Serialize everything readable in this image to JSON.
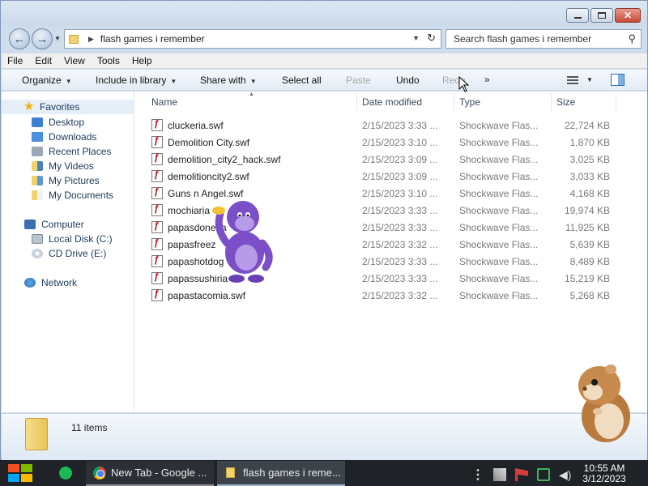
{
  "address": {
    "path": "flash games i remember",
    "search_placeholder": "Search flash games i remember"
  },
  "menu": [
    "File",
    "Edit",
    "View",
    "Tools",
    "Help"
  ],
  "toolbar": {
    "organize": "Organize",
    "include": "Include in library",
    "share": "Share with",
    "select_all": "Select all",
    "paste": "Paste",
    "undo": "Undo",
    "redo": "Redo",
    "more": "»"
  },
  "nav": {
    "favorites": "Favorites",
    "desktop": "Desktop",
    "downloads": "Downloads",
    "recent": "Recent Places",
    "videos": "My Videos",
    "pictures": "My Pictures",
    "documents": "My Documents",
    "computer": "Computer",
    "local_disk": "Local Disk (C:)",
    "cd_drive": "CD Drive (E:)",
    "network": "Network"
  },
  "columns": {
    "name": "Name",
    "date": "Date modified",
    "type": "Type",
    "size": "Size"
  },
  "files": [
    {
      "name": "cluckeria.swf",
      "date": "2/15/2023 3:33 ...",
      "type": "Shockwave Flas...",
      "size": "22,724 KB"
    },
    {
      "name": "Demolition City.swf",
      "date": "2/15/2023 3:10 ...",
      "type": "Shockwave Flas...",
      "size": "1,870 KB"
    },
    {
      "name": "demolition_city2_hack.swf",
      "date": "2/15/2023 3:09 ...",
      "type": "Shockwave Flas...",
      "size": "3,025 KB"
    },
    {
      "name": "demolitioncity2.swf",
      "date": "2/15/2023 3:09 ...",
      "type": "Shockwave Flas...",
      "size": "3,033 KB"
    },
    {
      "name": "Guns n Angel.swf",
      "date": "2/15/2023 3:10 ...",
      "type": "Shockwave Flas...",
      "size": "4,168 KB"
    },
    {
      "name": "mochiaria",
      "date": "2/15/2023 3:33 ...",
      "type": "Shockwave Flas...",
      "size": "19,974 KB"
    },
    {
      "name": "papasdoneria",
      "date": "2/15/2023 3:33 ...",
      "type": "Shockwave Flas...",
      "size": "11,925 KB"
    },
    {
      "name": "papasfreez",
      "date": "2/15/2023 3:32 ...",
      "type": "Shockwave Flas...",
      "size": "5,639 KB"
    },
    {
      "name": "papashotdog",
      "date": "2/15/2023 3:33 ...",
      "type": "Shockwave Flas...",
      "size": "8,489 KB"
    },
    {
      "name": "papassushiria",
      "date": "2/15/2023 3:33 ...",
      "type": "Shockwave Flas...",
      "size": "15,219 KB"
    },
    {
      "name": "papastacomia.swf",
      "date": "2/15/2023 3:32 ...",
      "type": "Shockwave Flas...",
      "size": "5,268 KB"
    }
  ],
  "status": {
    "items": "11 items"
  },
  "taskbar": {
    "task1": "New Tab - Google ...",
    "task2": "flash games i reme...",
    "time": "10:55 AM",
    "date": "3/12/2023"
  },
  "colors": {
    "window_frame": "#cfdcec",
    "taskbar": "#1f2226",
    "folder": "#f1d36d",
    "flash_icon": "#b51d1d"
  }
}
